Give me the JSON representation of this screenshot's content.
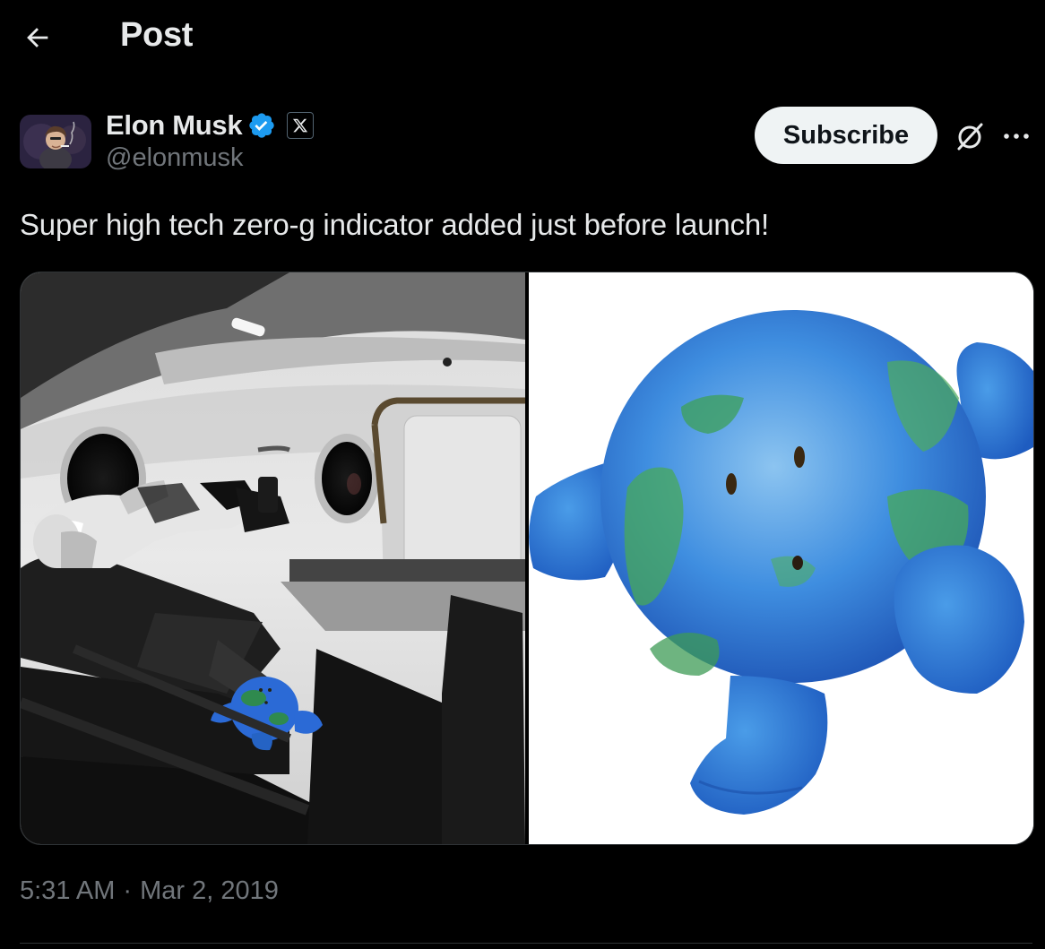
{
  "header": {
    "title": "Post",
    "back_icon": "arrow-left-icon"
  },
  "author": {
    "display_name": "Elon Musk",
    "handle": "@elonmusk",
    "verified": true,
    "verified_color": "#1d9bf0",
    "badge_icon": "x-logo-icon"
  },
  "actions": {
    "subscribe_label": "Subscribe",
    "grok_icon": "grok-icon",
    "more_icon": "more-dots-icon"
  },
  "post": {
    "text": "Super high tech zero-g indicator added just before launch!",
    "timestamp_time": "5:31 AM",
    "timestamp_sep": "·",
    "timestamp_date": "Mar 2, 2019"
  },
  "colors": {
    "background": "#000000",
    "text_primary": "#e7e9ea",
    "text_secondary": "#71767b",
    "border": "#2f3336",
    "button_bg": "#eff3f4",
    "button_text": "#0f1419",
    "accent": "#1d9bf0"
  }
}
